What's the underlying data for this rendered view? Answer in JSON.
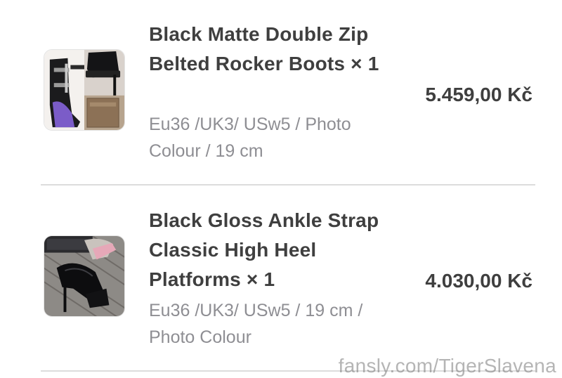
{
  "order_items": [
    {
      "name": "Black Matte Double Zip Belted Rocker Boots × 1",
      "variant": "Eu36 /UK3/ USw5 / Photo Colour / 19 cm",
      "price": "5.459,00 Kč",
      "thumbnail_icon": "boots-product-photo"
    },
    {
      "name": "Black Gloss Ankle Strap Classic High Heel Platforms × 1",
      "variant": "Eu36 /UK3/ USw5 / 19 cm / Photo Colour",
      "price": "4.030,00 Kč",
      "thumbnail_icon": "heels-product-photo"
    }
  ],
  "watermark": "fansly.com/TigerSlavena",
  "colors": {
    "text_primary": "#3f3f3f",
    "text_secondary": "#8e8e93",
    "divider": "#dcdcdc"
  }
}
